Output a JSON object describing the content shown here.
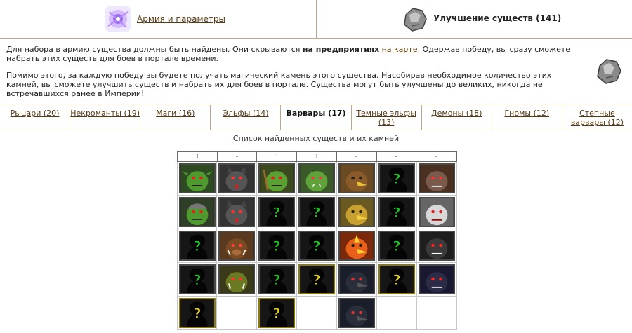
{
  "header": {
    "army_link": "Армия и параметры",
    "upgrade_title": "Улучшение существ (141)"
  },
  "info": {
    "p1_a": "Для набора в армию существа должны быть найдены. Они скрываются ",
    "p1_bold": "на предприятиях",
    "p1_link": "на карте",
    "p1_b": ". Одержав победу, вы сразу сможете набрать этих существ для боев в портале времени.",
    "p2": "Помимо этого, за каждую победу вы будете получать магический камень этого существа. Насобирав необходимое количество этих камней, вы сможете улучшить существ и набрать их для боев в портале. Существа могут быть улучшены до великих, никогда не встречавшихся ранее в Империи!"
  },
  "tabs": [
    {
      "label": "Рыцари (20)",
      "active": false
    },
    {
      "label": "Некроманты (19)",
      "active": false
    },
    {
      "label": "Маги (16)",
      "active": false
    },
    {
      "label": "Эльфы (14)",
      "active": false
    },
    {
      "label": "Варвары (17)",
      "active": true
    },
    {
      "label": "Темные эльфы (13)",
      "active": false
    },
    {
      "label": "Демоны (18)",
      "active": false
    },
    {
      "label": "Гномы (12)",
      "active": false
    },
    {
      "label": "Степные варвары (12)",
      "active": false
    }
  ],
  "list_title": "Список найденных существ и их камней",
  "columns": [
    {
      "count": "1"
    },
    {
      "count": "-"
    },
    {
      "count": "1"
    },
    {
      "count": "1"
    },
    {
      "count": "-"
    },
    {
      "count": "-"
    },
    {
      "count": "-"
    }
  ],
  "grid": [
    [
      "goblin",
      "wolf",
      "goblin_arch",
      "orc",
      "griffin_brown",
      "unknown_green",
      "beast_brown"
    ],
    [
      "goblin_helm",
      "wolf",
      "unknown_green",
      "unknown_green",
      "griffin_gold",
      "unknown_green",
      "beast_white"
    ],
    [
      "unknown_green",
      "boar",
      "unknown_green",
      "unknown_green",
      "phoenix",
      "unknown_green",
      "beast_black"
    ],
    [
      "unknown_green",
      "ogre",
      "unknown_green",
      "unknown_yellow",
      "bird_black",
      "unknown_yellow",
      "beast_purple"
    ],
    [
      "unknown_yellow",
      "",
      "unknown_yellow",
      "",
      "bird_black",
      "",
      ""
    ]
  ],
  "colors": {
    "border": "#c0a98a",
    "link": "#5a3a12",
    "unknown_green_q": "#22c822",
    "unknown_yellow_q": "#e6d21e"
  }
}
